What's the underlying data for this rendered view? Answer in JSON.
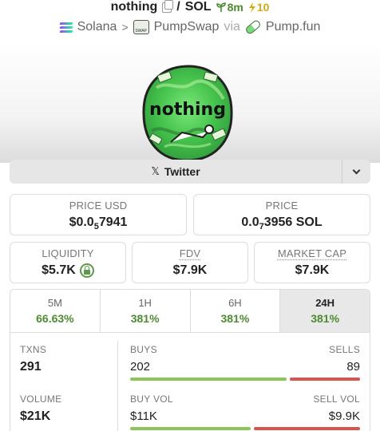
{
  "header": {
    "token_name": "nothing",
    "pair_separator": "/",
    "quote": "SOL",
    "age": "8m",
    "boosts": "10",
    "chain": "Solana",
    "dex": "PumpSwap",
    "via": "via",
    "launchpad": "Pump.fun"
  },
  "token_image_text": "nothing",
  "twitter": {
    "label": "Twitter"
  },
  "price_usd": {
    "label": "PRICE USD",
    "prefix": "$0.0",
    "zeros": "5",
    "digits": "7941"
  },
  "price_sol": {
    "label": "PRICE",
    "prefix": "0.0",
    "zeros": "7",
    "digits": "3956 SOL"
  },
  "liquidity": {
    "label": "LIQUIDITY",
    "value": "$5.7K"
  },
  "fdv": {
    "label": "FDV",
    "value": "$7.9K"
  },
  "market_cap": {
    "label": "MARKET CAP",
    "value": "$7.9K"
  },
  "timeframes": [
    {
      "key": "5M",
      "value": "66.63%"
    },
    {
      "key": "1H",
      "value": "381%"
    },
    {
      "key": "6H",
      "value": "381%"
    },
    {
      "key": "24H",
      "value": "381%",
      "active": true
    }
  ],
  "stats": {
    "txns": {
      "label": "TXNS",
      "value": "291"
    },
    "buys": {
      "label": "BUYS",
      "value": "202"
    },
    "sells": {
      "label": "SELLS",
      "value": "89"
    },
    "volume": {
      "label": "VOLUME",
      "value": "$21K"
    },
    "buy_vol": {
      "label": "BUY VOL",
      "value": "$11K"
    },
    "sell_vol": {
      "label": "SELL VOL",
      "value": "$9.9K"
    },
    "buy_share": 0.69,
    "buy_vol_share": 0.53
  },
  "colors": {
    "positive": "#4d8b31",
    "buy_bar": "#8cc65a",
    "sell_bar": "#d9534f",
    "boost": "#d4a814"
  }
}
